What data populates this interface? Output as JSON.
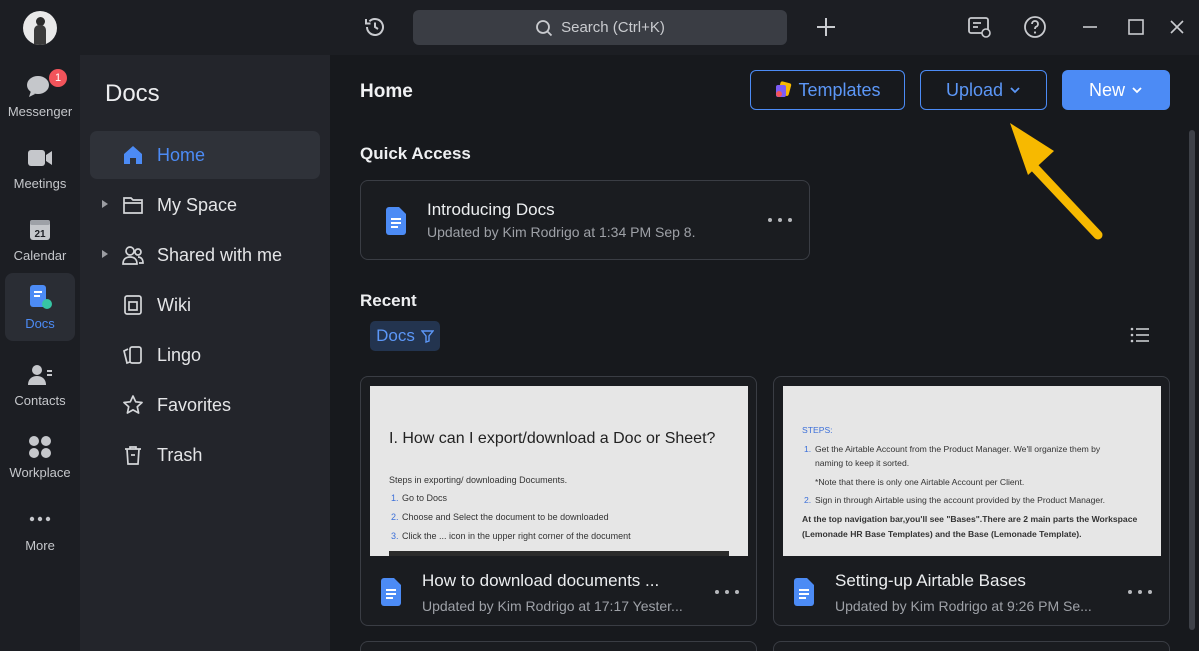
{
  "titlebar": {
    "search_placeholder": "Search (Ctrl+K)"
  },
  "rail": {
    "items": [
      {
        "label": "Messenger",
        "badge": "1"
      },
      {
        "label": "Meetings"
      },
      {
        "label": "Calendar",
        "icon_text": "21"
      },
      {
        "label": "Docs"
      },
      {
        "label": "Contacts"
      },
      {
        "label": "Workplace"
      },
      {
        "label": "More"
      }
    ]
  },
  "sidebar": {
    "title": "Docs",
    "items": [
      {
        "label": "Home"
      },
      {
        "label": "My Space"
      },
      {
        "label": "Shared with me"
      },
      {
        "label": "Wiki"
      },
      {
        "label": "Lingo"
      },
      {
        "label": "Favorites"
      },
      {
        "label": "Trash"
      }
    ]
  },
  "main": {
    "title": "Home",
    "templates_label": "Templates",
    "upload_label": "Upload",
    "new_label": "New",
    "quick_access_title": "Quick Access",
    "quick_access": {
      "name": "Introducing Docs",
      "meta": "Updated by Kim Rodrigo at 1:34 PM Sep 8."
    },
    "recent_title": "Recent",
    "filter_label": "Docs",
    "recent": [
      {
        "name": "How to download documents ...",
        "meta": "Updated by Kim Rodrigo at 17:17 Yester...",
        "thumb": {
          "heading": "I. How can I export/download a Doc or Sheet?",
          "intro": "Steps in exporting/ downloading Documents.",
          "steps": [
            {
              "n": "1.",
              "text": "Go to Docs"
            },
            {
              "n": "2.",
              "text": "Choose and Select the document to be downloaded"
            },
            {
              "n": "3.",
              "text": "Click the ... icon in the upper right corner of the document"
            }
          ]
        }
      },
      {
        "name": "Setting-up Airtable Bases",
        "meta": "Updated by Kim Rodrigo at 9:26 PM Se...",
        "thumb": {
          "steps_label": "STEPS:",
          "step1a": "Get the Airtable Account from the Product Manager. We'll organize them by",
          "step1b": "naming to keep it sorted.",
          "note": "*Note that there is only one Airtable Account per Client.",
          "step2": "Sign in through Airtable using the account provided by the Product Manager.",
          "para1": "At the top navigation bar,you'll see \"Bases\".There are 2 main parts the  Workspace",
          "para2": "(Lemonade HR Base Templates) and the Base (Lemonade Template)."
        }
      }
    ]
  },
  "colors": {
    "accent": "#4c8bf5",
    "arrow": "#f7b900",
    "badge": "#f2545b"
  }
}
